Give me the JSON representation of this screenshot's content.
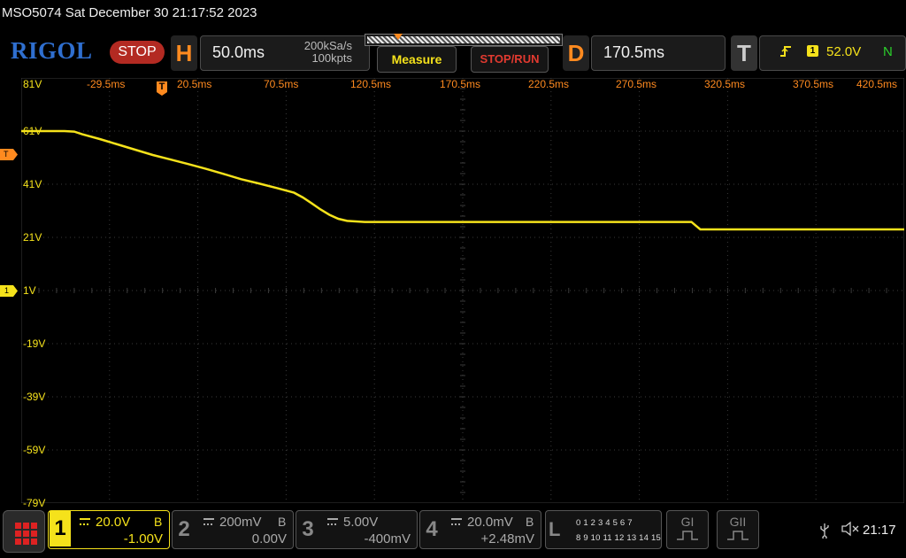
{
  "title": "MSO5074  Sat December 30 21:17:52 2023",
  "brand": "RIGOL",
  "run_status": "STOP",
  "horizontal": {
    "letter": "H",
    "timebase": "50.0ms",
    "sample_rate": "200kSa/s",
    "memory_depth": "100kpts"
  },
  "buttons": {
    "measure": "Measure",
    "stop_run": "STOP/RUN"
  },
  "delay": {
    "letter": "D",
    "value": "170.5ms"
  },
  "trigger": {
    "letter": "T",
    "edge_icon": "rising-edge-icon",
    "source": "1",
    "level": "52.0V",
    "mode": "N"
  },
  "time_ticks": [
    "-29.5ms",
    "20.5ms",
    "70.5ms",
    "120.5ms",
    "170.5ms",
    "220.5ms",
    "270.5ms",
    "320.5ms",
    "370.5ms",
    "420.5ms"
  ],
  "volt_ticks": [
    "81V",
    "61V",
    "41V",
    "21V",
    "1V",
    "-19V",
    "-39V",
    "-59V",
    "-79V"
  ],
  "markers": {
    "trigger_position": "T",
    "trigger_level": "T",
    "ch1_ground": "1"
  },
  "channels": [
    {
      "num": "1",
      "scale": "20.0V",
      "bw": "B",
      "offset": "-1.00V",
      "color": "#f5e21b",
      "active": true
    },
    {
      "num": "2",
      "scale": "200mV",
      "bw": "B",
      "offset": "0.00V",
      "color": "#8a8a8a",
      "active": false
    },
    {
      "num": "3",
      "scale": "5.00V",
      "bw": "",
      "offset": "-400mV",
      "color": "#8a8a8a",
      "active": false
    },
    {
      "num": "4",
      "scale": "20.0mV",
      "bw": "B",
      "offset": "+2.48mV",
      "color": "#8a8a8a",
      "active": false
    }
  ],
  "logic": {
    "letter": "L",
    "row1": "0 1 2 3  4 5 6 7",
    "row2": "8 9 10 11 12 13 14 15"
  },
  "generators": {
    "g1": "GI",
    "g2": "GII"
  },
  "status": {
    "clock": "21:17"
  },
  "colors": {
    "ch1": "#f5e21b",
    "accent": "#ff8a1f",
    "stop": "#b32a22",
    "grid": "#3a3a3a"
  },
  "chart_data": {
    "type": "line",
    "xlabel": "",
    "ylabel": "",
    "xlim": [
      -29.5,
      470.5
    ],
    "ylim": [
      -79,
      81
    ],
    "grid": true,
    "series": [
      {
        "x": [
          -29.5,
          -25,
          -15,
          -5,
          0.5,
          5,
          15,
          25,
          35,
          45,
          55,
          65,
          75,
          85,
          95,
          105,
          115,
          125,
          130,
          135,
          140,
          145,
          150,
          155,
          160,
          165,
          175,
          185,
          200,
          250,
          300,
          340,
          345,
          350,
          355,
          400,
          450,
          470.5
        ],
        "y": [
          61,
          61,
          61,
          61,
          60.8,
          59.8,
          58,
          56,
          54,
          52,
          50.3,
          48.6,
          46.8,
          44.9,
          42.9,
          41.3,
          39.6,
          37.8,
          36,
          33.8,
          31.5,
          29.5,
          28.0,
          27.2,
          27.0,
          26.8,
          26.8,
          26.8,
          26.8,
          26.8,
          26.8,
          26.8,
          26.8,
          26.8,
          24.0,
          24.0,
          24.0,
          24.0
        ]
      }
    ]
  }
}
